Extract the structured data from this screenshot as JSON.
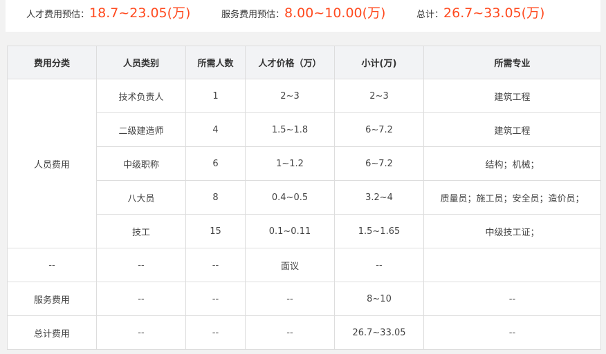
{
  "summary": {
    "talent_label": "人才费用预估：",
    "talent_value": "18.7~23.05(万)",
    "service_label": "服务费用预估：",
    "service_value": "8.00~10.00(万)",
    "total_label": "总计：",
    "total_value": "26.7~33.05(万)"
  },
  "table": {
    "headers": [
      "费用分类",
      "人员类别",
      "所需人数",
      "人才价格（万）",
      "小计(万)",
      "所需专业"
    ],
    "group_label": "人员费用",
    "rows": [
      {
        "type": "技术负责人",
        "count": "1",
        "price": "2~3",
        "subtotal": "2~3",
        "major": "建筑工程"
      },
      {
        "type": "二级建造师",
        "count": "4",
        "price": "1.5~1.8",
        "subtotal": "6~7.2",
        "major": "建筑工程"
      },
      {
        "type": "中级职称",
        "count": "6",
        "price": "1~1.2",
        "subtotal": "6~7.2",
        "major": "结构；机械；"
      },
      {
        "type": "八大员",
        "count": "8",
        "price": "0.4~0.5",
        "subtotal": "3.2~4",
        "major": "质量员；施工员；安全员；造价员；"
      },
      {
        "type": "技工",
        "count": "15",
        "price": "0.1~0.11",
        "subtotal": "1.5~1.65",
        "major": "中级技工证；"
      }
    ],
    "misc_row": {
      "category": "--",
      "type": "--",
      "count": "--",
      "price": "面议",
      "subtotal": "--",
      "major": ""
    },
    "service_row": {
      "category": "服务费用",
      "type": "--",
      "count": "--",
      "price": "--",
      "subtotal": "8~10",
      "major": "--"
    },
    "total_row": {
      "category": "总计费用",
      "type": "--",
      "count": "--",
      "price": "--",
      "subtotal": "26.7~33.05",
      "major": "--"
    }
  },
  "colors": {
    "accent": "#ff4a1f",
    "link_blue": "#2a95dc",
    "header_bg": "#f2f3f5",
    "border": "#dddddd"
  }
}
